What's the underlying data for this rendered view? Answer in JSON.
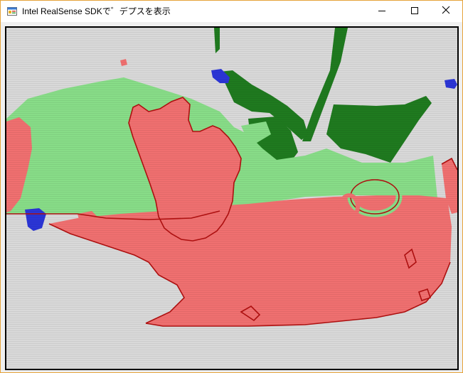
{
  "window": {
    "title": "Intel RealSense SDKで゛デプスを表示",
    "app_icon": "winforms-app-icon",
    "minimize_icon": "minimize-icon",
    "maximize_icon": "maximize-icon",
    "close_icon": "close-icon"
  },
  "depth_view": {
    "background_color": "#d9d9d9",
    "near_color": "#f07070",
    "mid_color": "#88dd88",
    "far_color": "#1f7a1f",
    "farthest_color": "#2b35d6",
    "edge_color": "#b01010"
  }
}
